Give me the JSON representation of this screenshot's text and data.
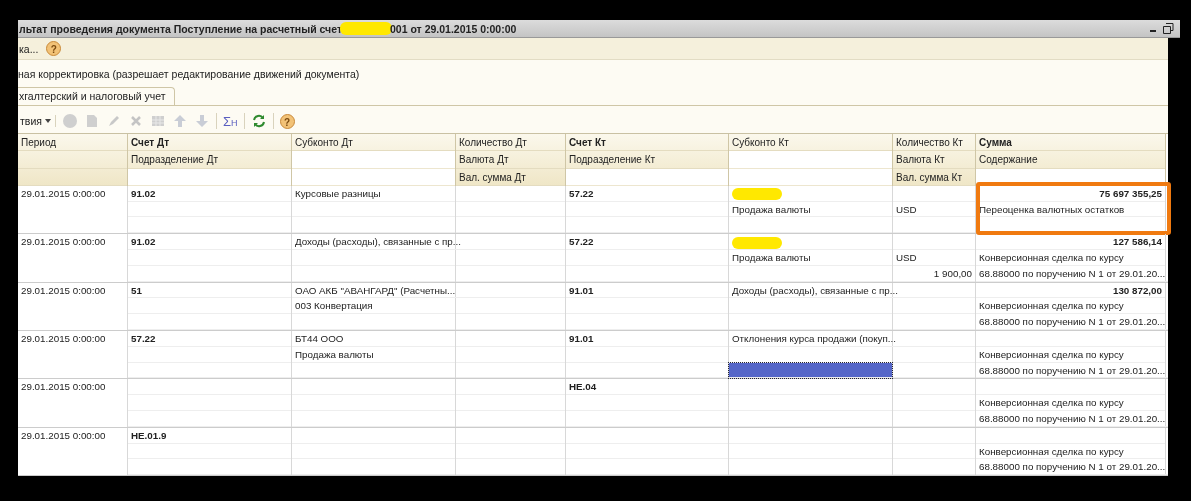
{
  "window": {
    "title_start": "льтат проведения документа Поступление на расчетный счет",
    "title_redacted": true,
    "title_end": "001 от 29.01.2015 0:00:00"
  },
  "command_bar": {
    "label": "ка...",
    "help_label": "?"
  },
  "manual_edit": {
    "label": "ная корректировка (разрешает редактирование движений документа)"
  },
  "tabs": [
    {
      "label": "хгалтерский и налоговый учет",
      "selected": true
    }
  ],
  "toolbar": {
    "actions_label": "твия",
    "sum_label": "Σ",
    "sum_sub": "Н",
    "help_label": "?"
  },
  "table": {
    "columns": [
      {
        "lines": [
          "Период"
        ],
        "bold": false
      },
      {
        "lines": [
          "Счет Дт",
          "Подразделение Дт"
        ],
        "bold": true
      },
      {
        "lines": [
          "Субконто Дт"
        ],
        "bold": false
      },
      {
        "lines": [
          "Количество Дт",
          "Валюта Дт",
          "Вал. сумма Дт"
        ],
        "bold": false
      },
      {
        "lines": [
          "Счет Кт",
          "Подразделение Кт"
        ],
        "bold": true
      },
      {
        "lines": [
          "Субконто Кт"
        ],
        "bold": false
      },
      {
        "lines": [
          "Количество Кт",
          "Валюта Кт",
          "Вал. сумма Кт"
        ],
        "bold": false
      },
      {
        "lines": [
          "Сумма",
          "Содержание"
        ],
        "bold": true
      }
    ],
    "rows": [
      {
        "period": {
          "line_1": "29.01.2015 0:00:00"
        },
        "account_dt": {
          "line_1": "91.02"
        },
        "subconto_dt": {
          "line_1": "Курсовые разницы"
        },
        "quantity_dt": {},
        "account_kt": {
          "line_1": "57.22"
        },
        "subconto_kt": {
          "line_2": "Продажа валюты",
          "redacted": true,
          "selected": false
        },
        "quantity_kt": {
          "line_2": "USD"
        },
        "amount": {
          "line_1": "75 697 355,25",
          "line_2": "Переоценка валютных остатков",
          "highlighted": true
        }
      },
      {
        "period": {
          "line_1": "29.01.2015 0:00:00"
        },
        "account_dt": {
          "line_1": "91.02"
        },
        "subconto_dt": {
          "line_1": "Доходы (расходы), связанные с пр..."
        },
        "quantity_dt": {},
        "account_kt": {
          "line_1": "57.22"
        },
        "subconto_kt": {
          "line_2": "Продажа валюты",
          "redacted": true,
          "selected": false
        },
        "quantity_kt": {
          "line_2": "USD",
          "line_3": "1 900,00"
        },
        "amount": {
          "line_1": "127 586,14",
          "line_2": "Конверсионная сделка по курсу",
          "line_3": "68.88000  по  поручению N 1 от 29.01.20...",
          "highlighted": false
        }
      },
      {
        "period": {
          "line_1": "29.01.2015 0:00:00"
        },
        "account_dt": {
          "line_1": "51"
        },
        "subconto_dt": {
          "line_1": "ОАО АКБ \"АВАНГАРД\" (Расчетны...",
          "line_2": "003 Конвертация"
        },
        "quantity_dt": {},
        "account_kt": {
          "line_1": "91.01"
        },
        "subconto_kt": {
          "line_1": "Доходы (расходы), связанные с пр...",
          "redacted": false,
          "selected": false
        },
        "quantity_kt": {},
        "amount": {
          "line_1": "130 872,00",
          "line_2": "Конверсионная сделка по курсу",
          "line_3": "68.88000  по  поручению N 1 от 29.01.20...",
          "highlighted": false
        }
      },
      {
        "period": {
          "line_1": "29.01.2015 0:00:00"
        },
        "account_dt": {
          "line_1": "57.22"
        },
        "subconto_dt": {
          "line_1": "БТ44 ООО",
          "line_2": "Продажа валюты"
        },
        "quantity_dt": {},
        "account_kt": {
          "line_1": "91.01"
        },
        "subconto_kt": {
          "line_1": "Отклонения курса продажи (покуп...",
          "redacted": false,
          "selected": true
        },
        "quantity_kt": {},
        "amount": {
          "line_2": "Конверсионная сделка по курсу",
          "line_3": "68.88000  по  поручению N 1 от 29.01.20...",
          "highlighted": false
        }
      },
      {
        "period": {
          "line_1": "29.01.2015 0:00:00"
        },
        "account_dt": {},
        "subconto_dt": {},
        "quantity_dt": {},
        "account_kt": {
          "line_1": "НЕ.04"
        },
        "subconto_kt": {
          "redacted": false,
          "selected": false
        },
        "quantity_kt": {},
        "amount": {
          "line_2": "Конверсионная сделка по курсу",
          "line_3": "68.88000  по  поручению N 1 от 29.01.20...",
          "highlighted": false
        }
      },
      {
        "period": {
          "line_1": "29.01.2015 0:00:00"
        },
        "account_dt": {
          "line_1": "НЕ.01.9"
        },
        "subconto_dt": {},
        "quantity_dt": {},
        "account_kt": {},
        "subconto_kt": {
          "redacted": false,
          "selected": false
        },
        "quantity_kt": {},
        "amount": {
          "line_2": "Конверсионная сделка по курсу",
          "line_3": "68.88000  по  поручению N 1 от 29.01.20...",
          "highlighted": false
        }
      }
    ]
  }
}
